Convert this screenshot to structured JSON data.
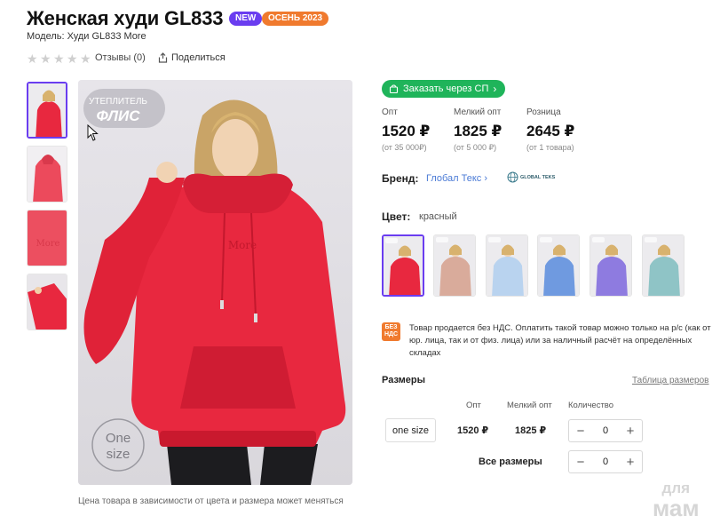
{
  "product": {
    "title": "Женская худи GL833",
    "badges": {
      "new": "NEW",
      "season": "ОСЕНЬ 2023"
    },
    "model": "Модель: Худи GL833 More",
    "reviews": "Отзывы (0)",
    "share": "Поделиться",
    "rating_stars": 0
  },
  "gallery": {
    "image_text": {
      "insulation": "УТЕПЛИТЕЛЬ",
      "fleece": "ФЛИС",
      "size_one": "One",
      "size_size": "size",
      "chest_logo": "More"
    },
    "caption": "Цена товара в зависимости от цвета и размера может меняться"
  },
  "order": {
    "sp_button": "Заказать через СП"
  },
  "prices": [
    {
      "label": "Опт",
      "value": "1520 ₽",
      "note": "(от 35 000₽)"
    },
    {
      "label": "Мелкий опт",
      "value": "1825 ₽",
      "note": "(от 5 000 ₽)"
    },
    {
      "label": "Розница",
      "value": "2645 ₽",
      "note": "(от 1 товара)"
    }
  ],
  "brand": {
    "label": "Бренд:",
    "value": "Глобал Текс",
    "logo_text": "GLOBAL TEKS"
  },
  "color": {
    "label": "Цвет:",
    "value": "красный"
  },
  "swatches": [
    {
      "name": "red",
      "color": "#e8283f"
    },
    {
      "name": "beige",
      "color": "#d9ab9b"
    },
    {
      "name": "light-blue",
      "color": "#b9d3ef"
    },
    {
      "name": "blue",
      "color": "#6f9ae0"
    },
    {
      "name": "violet",
      "color": "#8e7be0"
    },
    {
      "name": "mint",
      "color": "#8fc4c6"
    }
  ],
  "vat": {
    "icon_line1": "БЕЗ",
    "icon_line2": "НДС",
    "text": "Товар продается без НДС. Оплатить такой товар можно только на р/с (как от юр. лица, так и от физ. лица) или за наличный расчёт на определённых складах"
  },
  "sizes": {
    "label": "Размеры",
    "table_link": "Таблица размеров",
    "headers": {
      "opt": "Опт",
      "small_opt": "Мелкий опт",
      "qty": "Количество"
    },
    "rows": [
      {
        "size": "one size",
        "opt": "1520 ₽",
        "small_opt": "1825 ₽",
        "qty": "0"
      }
    ],
    "all_sizes_label": "Все размеры",
    "all_sizes_qty": "0"
  },
  "watermark": {
    "line1": "для",
    "line2": "мам"
  },
  "colors": {
    "accent": "#6a3df0",
    "green": "#1fb45a",
    "orange": "#f07a2e",
    "link": "#4b7bd6",
    "hoodie_red": "#e8283f"
  }
}
